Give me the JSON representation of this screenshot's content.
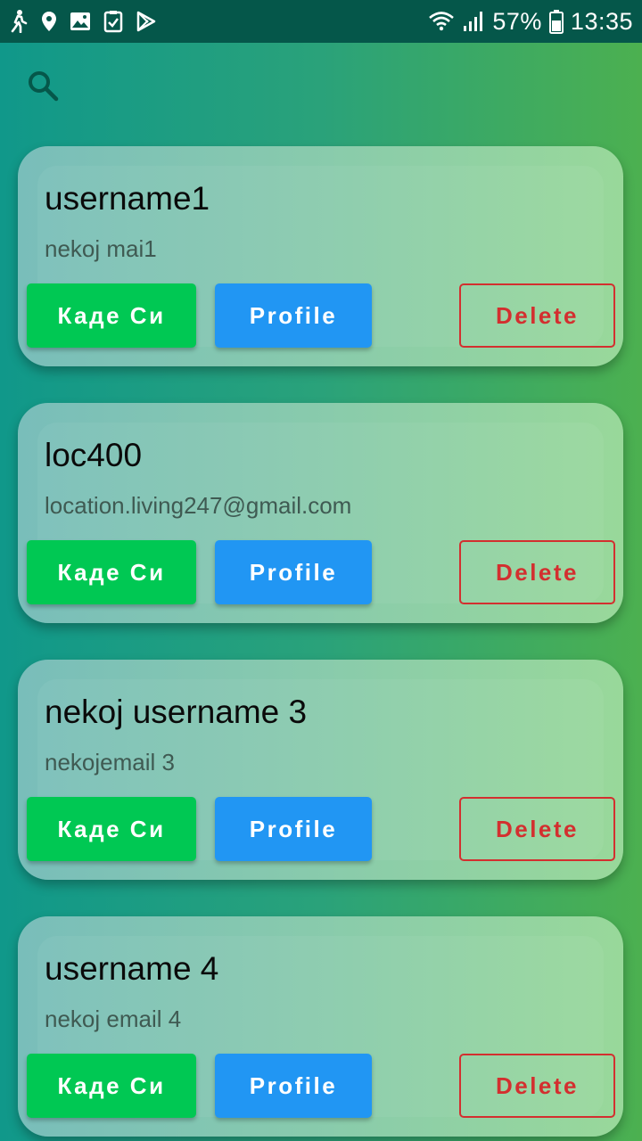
{
  "status_bar": {
    "icons_left": [
      "walk-icon",
      "location-pin-icon",
      "image-icon",
      "clipboard-check-icon",
      "play-store-icon"
    ],
    "icons_right": [
      "wifi-icon",
      "signal-icon",
      "battery-icon"
    ],
    "battery": "57%",
    "time": "13:35"
  },
  "toolbar": {
    "search_icon": "search-icon"
  },
  "users": [
    {
      "username": "username1",
      "email": "nekoj mai1",
      "kade_label": "Каде Си",
      "profile_label": "Profile",
      "delete_label": "Delete"
    },
    {
      "username": "loc400",
      "email": "location.living247@gmail.com",
      "kade_label": "Каде Си",
      "profile_label": "Profile",
      "delete_label": "Delete"
    },
    {
      "username": "nekoj username 3",
      "email": "nekojemail 3",
      "kade_label": "Каде Си",
      "profile_label": "Profile",
      "delete_label": "Delete"
    },
    {
      "username": "username 4",
      "email": "nekoj email 4",
      "kade_label": "Каде Си",
      "profile_label": "Profile",
      "delete_label": "Delete"
    }
  ],
  "colors": {
    "status_bar": "#05574a",
    "background_start": "#10988a",
    "background_end": "#4cb050",
    "kade_button": "#00c853",
    "profile_button": "#2196f3",
    "delete_button": "#d32f2f"
  }
}
